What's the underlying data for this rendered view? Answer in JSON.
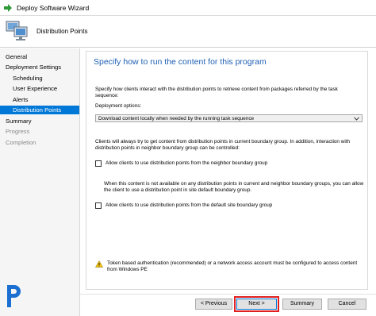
{
  "window": {
    "title": "Deploy Software Wizard",
    "app_icon": "green-arrow-icon"
  },
  "header": {
    "title": "Distribution Points",
    "icon": "computer-monitors-icon"
  },
  "sidebar": {
    "items": [
      {
        "label": "General",
        "level": "top",
        "state": "normal"
      },
      {
        "label": "Deployment Settings",
        "level": "top",
        "state": "normal"
      },
      {
        "label": "Scheduling",
        "level": "sub",
        "state": "normal"
      },
      {
        "label": "User Experience",
        "level": "sub",
        "state": "normal"
      },
      {
        "label": "Alerts",
        "level": "sub",
        "state": "normal"
      },
      {
        "label": "Distribution Points",
        "level": "sub",
        "state": "active"
      },
      {
        "label": "Summary",
        "level": "top",
        "state": "normal"
      },
      {
        "label": "Progress",
        "level": "top",
        "state": "disabled"
      },
      {
        "label": "Completion",
        "level": "top",
        "state": "disabled"
      }
    ]
  },
  "main": {
    "heading": "Specify how to run the content for this program",
    "intro_line1": "Specify how clients interact with the distribution points to retrieve content from packages referred by the task",
    "intro_line2": "sequence:",
    "deployment_options_label": "Deployment options:",
    "deployment_options_value": "Download content locally when needed by the running task sequence",
    "boundary_text_line1": "Clients will always try to get content from distribution points in current boundary group. In addition, interaction with",
    "boundary_text_line2": "distribution points in neighbor boundary group can be controlled:",
    "checkbox_neighbor": {
      "label": "Allow clients to use distribution points from the neighbor boundary group",
      "checked": false
    },
    "fallback_text_line1": "When this content is not available on any distribution points in current and neighbor boundary groups, you can allow",
    "fallback_text_line2": "the client to use a distribution point in site default boundary group.",
    "checkbox_default": {
      "label": "Allow clients to use distribution points from the default site boundary group",
      "checked": false
    },
    "warning_line1": "Token based authentication (recommended) or a network access account must be configured to access content",
    "warning_line2": "from Windows PE"
  },
  "buttons": {
    "previous": "< Previous",
    "next": "Next >",
    "summary": "Summary",
    "cancel": "Cancel"
  },
  "colors": {
    "accent": "#0078d7",
    "heading": "#1e5fb4",
    "highlight_box": "#e02020"
  }
}
